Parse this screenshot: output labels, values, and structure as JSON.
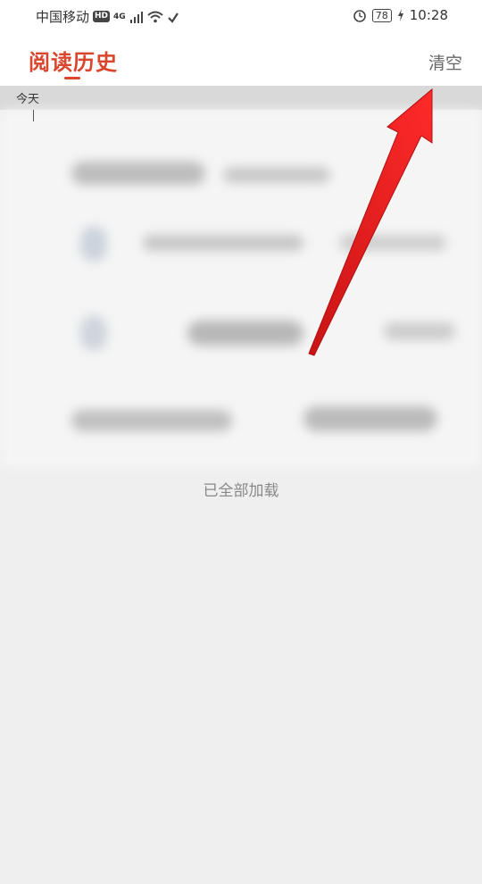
{
  "status_bar": {
    "carrier": "中国移动",
    "hd": "HD",
    "network": "4G",
    "battery": "78",
    "time": "10:28"
  },
  "header": {
    "title": "阅读历史",
    "clear_label": "清空"
  },
  "history": {
    "section_label": "今天",
    "end_text": "已全部加载"
  },
  "colors": {
    "accent": "#d9452d",
    "annotation_arrow": "#e21d1d"
  },
  "annotation": {
    "icon": "red-arrow-icon"
  }
}
